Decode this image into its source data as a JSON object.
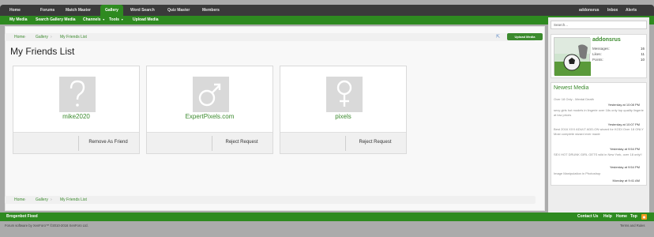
{
  "topnav": {
    "items": [
      "Home",
      "Forums",
      "Match Master",
      "Gallery",
      "Word Search",
      "Quiz Master",
      "Members"
    ],
    "right": [
      "addonsrus",
      "Inbox",
      "Alerts"
    ]
  },
  "subnav": {
    "items": [
      "My Media",
      "Search Gallery Media",
      "Channels",
      "Tools",
      "Upload Media"
    ]
  },
  "breadcrumb": [
    "Home",
    "Gallery",
    "My Friends List"
  ],
  "page_title": "My Friends List",
  "upload_button": "Upload Media",
  "friends": [
    {
      "name": "mike2020",
      "action": "Remove As Friend",
      "icon": "question-icon"
    },
    {
      "name": "ExpertPixels.com",
      "action": "Reject Request",
      "icon": "male-icon"
    },
    {
      "name": "pixels",
      "action": "Reject Request",
      "icon": "female-icon"
    }
  ],
  "sidebar": {
    "search_placeholder": "Search...",
    "user": {
      "name": "addonsrus",
      "stats": [
        {
          "label": "Messages:",
          "value": "16"
        },
        {
          "label": "Likes:",
          "value": "11"
        },
        {
          "label": "Points:",
          "value": "10"
        }
      ]
    },
    "newest_media_title": "Newest Media",
    "media": [
      {
        "title": "Over 18 Only - Mental Death",
        "time": "Yesterday at 10:08 PM"
      },
      {
        "title": "sexy girls hot models in lingerie over 18s only top quality lingerie at low prices",
        "time": "Yesterday at 10:07 PM"
      },
      {
        "title": "Best 2016 XXX ADULT ADD-ON wizard for KODI Over 18 ONLY Most complete wizard ever made",
        "time": "Yesterday at 9:54 PM"
      },
      {
        "title": "SEX HOT DRUNK GIRL GETS wild in New York, over 18 only!!",
        "time": "Yesterday at 9:54 PM"
      },
      {
        "title": "Image Manipulation in Photoshop",
        "time": "Monday at 9:41 AM"
      }
    ]
  },
  "footer": {
    "left": "Brogenbot Fixed",
    "links": [
      "Contact Us",
      "Help",
      "Home",
      "Top"
    ],
    "copyright": "Forum software by XenForo™ ©2010-2016 XenForo Ltd.",
    "terms": "Terms and Rules"
  },
  "colors": {
    "brand_green": "#2e8a20",
    "link_green": "#3b8a2d",
    "topbar_dark": "#3a3a3a"
  }
}
